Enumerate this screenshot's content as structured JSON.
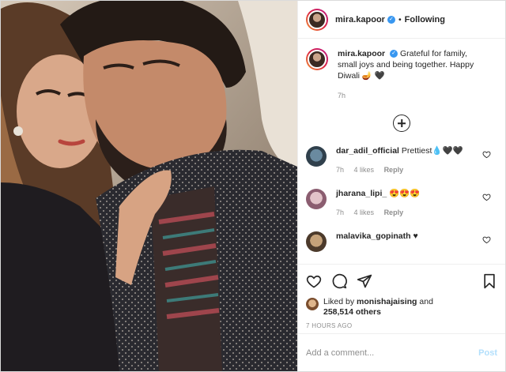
{
  "header": {
    "username": "mira.kapoor",
    "separator": "•",
    "follow_status": "Following",
    "verified_glyph": "✓"
  },
  "caption": {
    "username": "mira.kapoor",
    "text": "Grateful for family, small joys and being together. Happy Diwali 🪔 🖤",
    "time": "7h"
  },
  "comments": [
    {
      "username": "dar_adil_official",
      "text": "Prettiest💧🖤🖤",
      "time": "7h",
      "likes": "4 likes",
      "reply": "Reply"
    },
    {
      "username": "jharana_lipi_",
      "text": "😍😍😍",
      "time": "7h",
      "likes": "4 likes",
      "reply": "Reply"
    },
    {
      "username": "malavika_gopinath",
      "text": "♥"
    }
  ],
  "likes": {
    "prefix": "Liked by",
    "user": "monishajaising",
    "conj": "and",
    "others": "258,514 others"
  },
  "timestamp": "7 HOURS AGO",
  "add_comment": {
    "placeholder": "Add a comment...",
    "post_label": "Post"
  },
  "icons": {
    "like": "heart-icon",
    "comment": "comment-icon",
    "share": "share-icon",
    "save": "bookmark-icon",
    "load_more": "plus-circle-icon"
  }
}
